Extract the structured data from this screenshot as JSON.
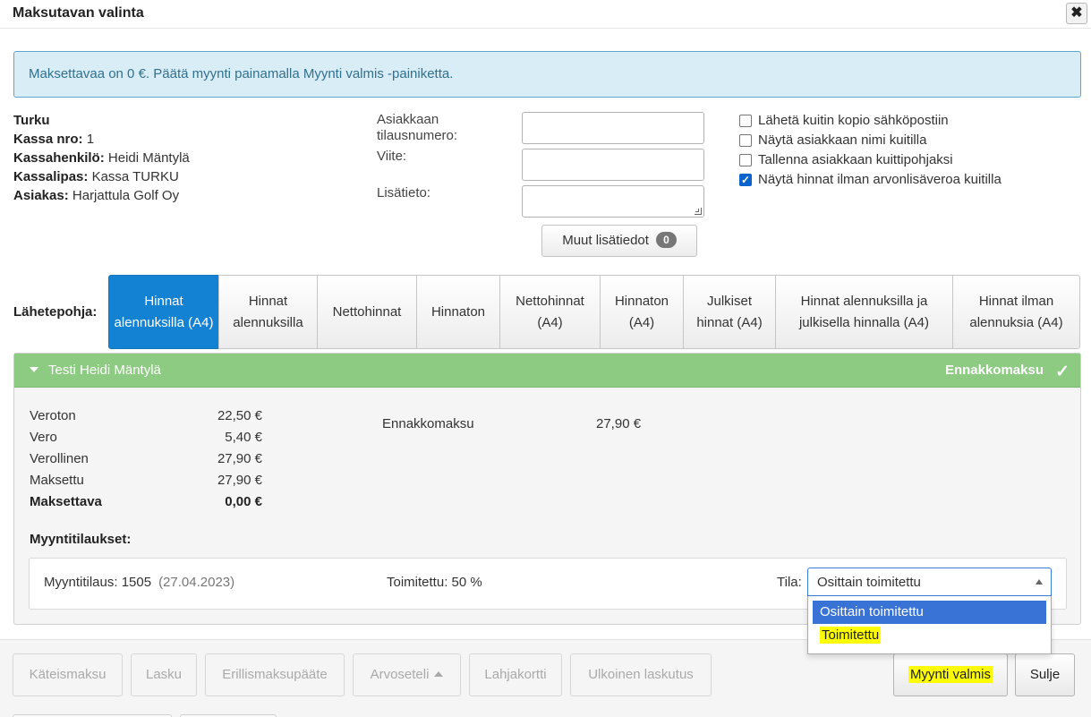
{
  "dialog": {
    "title": "Maksutavan valinta",
    "close_label": "✖"
  },
  "alert": {
    "text": "Maksettavaa on 0 €. Päätä myynti painamalla Myynti valmis -painiketta."
  },
  "meta": {
    "location": "Turku",
    "register_label": "Kassa nro:",
    "register_value": "1",
    "cashier_label": "Kassahenkilö:",
    "cashier_value": "Heidi Mäntylä",
    "cashbox_label": "Kassalipas:",
    "cashbox_value": "Kassa TURKU",
    "customer_label": "Asiakas:",
    "customer_value": "Harjattula Golf Oy"
  },
  "form": {
    "order_number_label": "Asiakkaan tilausnumero:",
    "order_number_value": "",
    "reference_label": "Viite:",
    "reference_value": "",
    "extra_info_label": "Lisätieto:",
    "extra_info_value": "",
    "more_info_label": "Muut lisätiedot",
    "more_info_count": "0"
  },
  "options": [
    {
      "label": "Lähetä kuitin kopio sähköpostiin",
      "checked": false
    },
    {
      "label": "Näytä asiakkaan nimi kuitilla",
      "checked": false
    },
    {
      "label": "Tallenna asiakkaan kuittipohjaksi",
      "checked": false
    },
    {
      "label": "Näytä hinnat ilman arvonlisäveroa kuitilla",
      "checked": true
    }
  ],
  "template": {
    "label": "Lähetepohja:",
    "tabs": [
      {
        "label": "Hinnat alennuksilla (A4)",
        "active": true
      },
      {
        "label": "Hinnat alennuksilla",
        "active": false
      },
      {
        "label": "Nettohinnat",
        "active": false
      },
      {
        "label": "Hinnaton",
        "active": false
      },
      {
        "label": "Nettohinnat (A4)",
        "active": false
      },
      {
        "label": "Hinnaton (A4)",
        "active": false
      },
      {
        "label": "Julkiset hinnat (A4)",
        "active": false
      },
      {
        "label": "Hinnat alennuksilla ja julkisella hinnalla (A4)",
        "active": false
      },
      {
        "label": "Hinnat ilman alennuksia (A4)",
        "active": false
      }
    ]
  },
  "payment_panel": {
    "name": "Testi Heidi Mäntylä",
    "status": "Ennakkomaksu",
    "sums": [
      {
        "label": "Veroton",
        "value": "22,50 €"
      },
      {
        "label": "Vero",
        "value": "5,40 €"
      },
      {
        "label": "Verollinen",
        "value": "27,90 €"
      },
      {
        "label": "Maksettu",
        "value": "27,90 €"
      },
      {
        "label": "Maksettava",
        "value": "0,00 €"
      }
    ],
    "advance_label": "Ennakkomaksu",
    "advance_value": "27,90 €",
    "orders_title": "Myyntitilaukset:",
    "order": {
      "label": "Myyntitilaus: 1505",
      "date": "(27.04.2023)",
      "delivered": "Toimitettu: 50 %",
      "state_label": "Tila:",
      "state_value": "Osittain toimitettu",
      "state_options": [
        "Osittain toimitettu",
        "Toimitettu"
      ]
    }
  },
  "footer": {
    "buttons": [
      "Käteismaksu",
      "Lasku",
      "Erillismaksupääte",
      "Arvoseteli",
      "Lahjakortti",
      "Ulkoinen laskutus"
    ],
    "finish_label": "Myynti valmis",
    "close_label": "Sulje"
  },
  "colors": {
    "accent": "#1482d2",
    "panel_header": "#8dcb82",
    "highlight": "#ffff00",
    "alert_bg": "#d9edf7"
  }
}
